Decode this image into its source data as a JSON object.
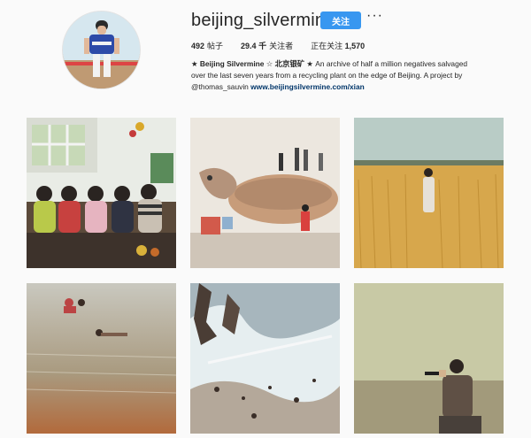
{
  "profile": {
    "username": "beijing_silvermine",
    "follow_label": "关注",
    "more_label": "···",
    "posts_count": "492",
    "posts_label": "帖子",
    "followers_count": "29.4 千",
    "followers_label": "关注者",
    "following_label": "正在关注",
    "following_count": "1,570",
    "bio_name": "★ Beijing Silvermine ☆ 北京银矿 ★",
    "bio_text": " An archive of half a million negatives salvaged over the last seven years from a recycling plant on the edge of Beijing. A project by ",
    "bio_handle": "@thomas_sauvin",
    "bio_link": "www.beijingsilvermine.com/xian"
  },
  "colors": {
    "follow_button": "#3897f0",
    "link": "#003569",
    "text": "#262626",
    "background": "#fafafa"
  },
  "posts": [
    {
      "subject": "group of six women seated indoors"
    },
    {
      "subject": "giant turtle statue with people on top"
    },
    {
      "subject": "man standing in wheat field"
    },
    {
      "subject": "people swimming in water"
    },
    {
      "subject": "damaged negative landscape"
    },
    {
      "subject": "man drinking from bottle on hillside"
    }
  ]
}
